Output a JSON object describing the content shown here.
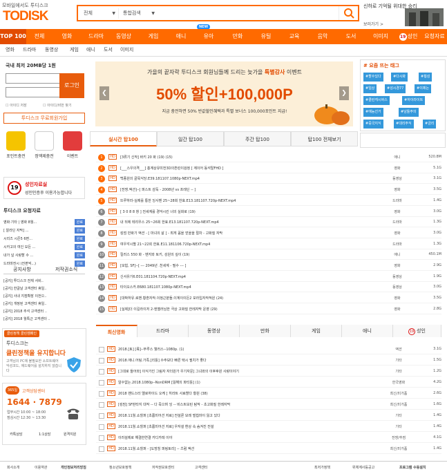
{
  "header": {
    "tagline": "모바일에서도 투디스크",
    "logo": "TODISK",
    "search_cat1": "전체",
    "search_cat2": "통합검색",
    "ad_text": "신하로 기억될 위대한 승리",
    "ad_more": "보러가기 >"
  },
  "nav": [
    "TOP 100",
    "전체",
    "영화",
    "드라마",
    "동영상",
    "게임",
    "애니",
    "유아",
    "만화",
    "유틸",
    "교육",
    "음악",
    "도서",
    "이미지",
    "성인",
    "요청자료"
  ],
  "new_badge": "NEW",
  "subnav": [
    "영화",
    "드라마",
    "동영상",
    "게임",
    "애니",
    "도서",
    "이미지"
  ],
  "login": {
    "title": "국내 최저 20MB당 1원",
    "button": "로그인",
    "save_id": "아이디 저장",
    "find": "아이디/비번 찾기",
    "join": "투디스크 무료회원가입"
  },
  "quick": [
    "포인트충전",
    "정액제충전",
    "이벤트"
  ],
  "adult": {
    "badge": "19",
    "title": "성인자료실",
    "desc": "성인인증후 이용가능합니다"
  },
  "request": {
    "title": "투디스크 요청자료",
    "items": [
      "영화·기타 | 영화 8월...",
      "[ 알라딘 자막] ...",
      "시리즈 시즌5 6편...",
      "시카고의 여인 모든 ...",
      "내가 널 사랑할 수 ...",
      "드라마전시 (전편씩...)"
    ],
    "badge": "완료"
  },
  "notice_tabs": [
    "공지사항",
    "저작권소식"
  ],
  "notices": [
    "[공지] 투디스크 전체 서비..",
    "[공지] 한글날 고객센터 휴일..",
    "[공지] 사내 지점확장 이전으..",
    "[공지] 개정된 고객센터 휴일..",
    "[공지] 2018 추석 고객센터 ..",
    "[공지] 2018 월특근 고객센터 .."
  ],
  "clean": {
    "badge": "클린정책 클린캠페인",
    "t1": "투디스크는",
    "t2": "클린정책을 유지합니다",
    "t3": "고객님의 PC에 불필요한 소프트웨어 악성코드, 애드웨어를 설치하지 않습니다"
  },
  "cs": {
    "badge": "365일",
    "title": "고객상담센터",
    "phone": "1644 · 7879",
    "hours": "업무시간 10:00 ~ 18:00",
    "lunch": "점심시간 12:30 ~ 13:30",
    "links": [
      "카톡상담",
      "1:1상담",
      "원격지원"
    ]
  },
  "banner": {
    "top_a": "가을의 끝자락 투디스크 회원님들께 드리는 늦가을 ",
    "top_b": "특별감사",
    "top_c": " 이벤트",
    "main": "50% 할인+100,000P",
    "sub": "지금 충전하면 50% 반값할인혜택과 특별 보너스 100,000포인트 지급!"
  },
  "hot": {
    "title": "# 요즘 뜨는 태그",
    "tags": [
      "#할수있다",
      "#다시봐",
      "#횡성",
      "#일상",
      "#성시경77",
      "#이제는",
      "#클린캐시버스",
      "#하이라이트",
      "#예능선거",
      "#남들주의",
      "#중국지식",
      "#대리주식",
      "#금리"
    ]
  },
  "rank_tabs": [
    "실시간 탑100",
    "일간 탑100",
    "주간 탑100",
    "탑100 전체보기"
  ],
  "ranks": [
    {
      "n": "1",
      "t": "[3류기 신작] 바키 20 화 (19)  (15)",
      "c": "애니",
      "s": "520.8M"
    },
    {
      "n": "2",
      "t": "[___스우의격___] 홍계상유미전3D의흔린이검정 [ 계이어 동석탈FHD ]",
      "c": "영화",
      "s": "5.1G"
    },
    {
      "n": "3",
      "t": "백종원의 골목식당.E39.181107.1080p-NEXT.mp4",
      "c": "동영상",
      "s": "3.1G"
    },
    {
      "n": "4",
      "t": "[전쟁.액션]--[ 퍼스트 감독 - 2008년 vs 프레딘 -- ]",
      "c": "영화",
      "s": "3.5G"
    },
    {
      "n": "5",
      "t": "뜨루하라-실제를 통한 잉사벤 25~28회 한효.E13.181107.720p-NEXT.mp4",
      "c": "드라마",
      "s": "1.4G"
    },
    {
      "n": "6",
      "t": "[ 3 0 8 8 창 ] 전세계를 경악시킨 너의 실화로 (19) ",
      "c": "영화",
      "s": "3.0G"
    },
    {
      "n": "7",
      "t": "내 뒤에 테리우스 25~26회 한효.E13.181107.720p-NEXT.mp4",
      "c": "드라마",
      "s": "1.3G"
    },
    {
      "n": "8",
      "t": "킹덤 만화기 액션 - [ 마녀의 삶 ] - 최게 꼼을 얻을을 절차 - 고화질 자막",
      "c": "영화",
      "s": "3.0G"
    },
    {
      "n": "9",
      "t": "여우각시별 21~22회 한효.E11.181106.720p-NEXT.mp4",
      "c": "드라마",
      "s": "1.3G"
    },
    {
      "n": "10",
      "t": "킬러스 550 화 - 벤지와 토키, 성원의 깊이 (19)",
      "c": "애니",
      "s": "450.1M"
    },
    {
      "n": "11",
      "t": "[모험, SF]--[ --- 2049년 .천세계 - 필수 --- ]",
      "c": "영화",
      "s": "2.9G"
    },
    {
      "n": "12",
      "t": "신서유기6.E01.181104.720p-NEXT.mp4",
      "c": "동영상",
      "s": "1.9G"
    },
    {
      "n": "13",
      "t": "타이오스카.E680.181107.1080p-NEXT.mp4",
      "c": "동영상",
      "s": "3.0G"
    },
    {
      "n": "14",
      "t": "[대박하유.로맨.황혼자작.이정근분들.이계이이든2 모라입자작적원 (24)",
      "c": "영화",
      "s": "3.5G"
    },
    {
      "n": "15",
      "t": "[실제]더 이길라이저 2-엔젤러님한 극상 고화질 한레자막 운영 (29)",
      "c": "영화",
      "s": "2.8G"
    }
  ],
  "new_tabs": [
    "최신영화",
    "드라마",
    "동영상",
    "만화",
    "게임",
    "애니",
    "성인"
  ],
  "news": [
    {
      "t": "2018.[토] [륙]--뚜루스 웰러스--1080p. (1)",
      "c": "액션",
      "s": "3.1G"
    },
    {
      "t": "2018.애니.어팅.가족.[리틀] 수주보다 빠른 택시 필치가 좋다",
      "c": "기타",
      "s": "1.5G"
    },
    {
      "t": "[그대로 들어와] 이식가진 그림자 자더원가 우기자문] 그녀와의 이후후원 사랑이야기",
      "c": "기타",
      "s": "1.2G"
    },
    {
      "t": "알수없는.2018.1080p--NonDRM [잃해의 파티틀] (1)",
      "c": "한국영화",
      "s": "4.2G"
    },
    {
      "t": "2018 밴드스터 엘로하이드 오케 [ 히라트 사료할다 황원 (38)",
      "c": "최신/미가품",
      "s": "2.6G"
    },
    {
      "t": "[킹덤] SF판타지 대작 -- 다 죽으며 잉 -- 비스트보린 탐작 - 초고화질 한레자막",
      "c": "최신/미가품",
      "s": "1.6G"
    },
    {
      "t": "2018.11월.쇼힐퍼 [초롬미어션 저료] 전설론 모레 벌칩마이 잃고 있다",
      "c": "기타",
      "s": "1.4G"
    },
    {
      "t": "2018.11월.쇼힐퍼 [초롬미어션 저료] 우자설 환상 속 숨겨진 전설",
      "c": "기타",
      "s": "1.4G"
    },
    {
      "t": "이러설제로 해결한연결 카디카레 이야",
      "c": "전쟁/추점",
      "s": "4.1G"
    },
    {
      "t": "2018.11월.쇼힐퍼 - [도망칭 퍼링토리] -- 츠럼 액션",
      "c": "최신/미가품",
      "s": "1.4G"
    }
  ],
  "footer": [
    "회사소개",
    "이용약관",
    "개인정보처리방침",
    "청소년보호정책",
    "저작권보호센터",
    "고객센터",
    "최저가정책",
    "위체계사등공고",
    "프로그램 수동설치"
  ],
  "colors": {
    "accent": "#ff6a00",
    "dark": "#e24b00",
    "rank_hot": "#ff6a00",
    "rank_cold": "#888888"
  }
}
